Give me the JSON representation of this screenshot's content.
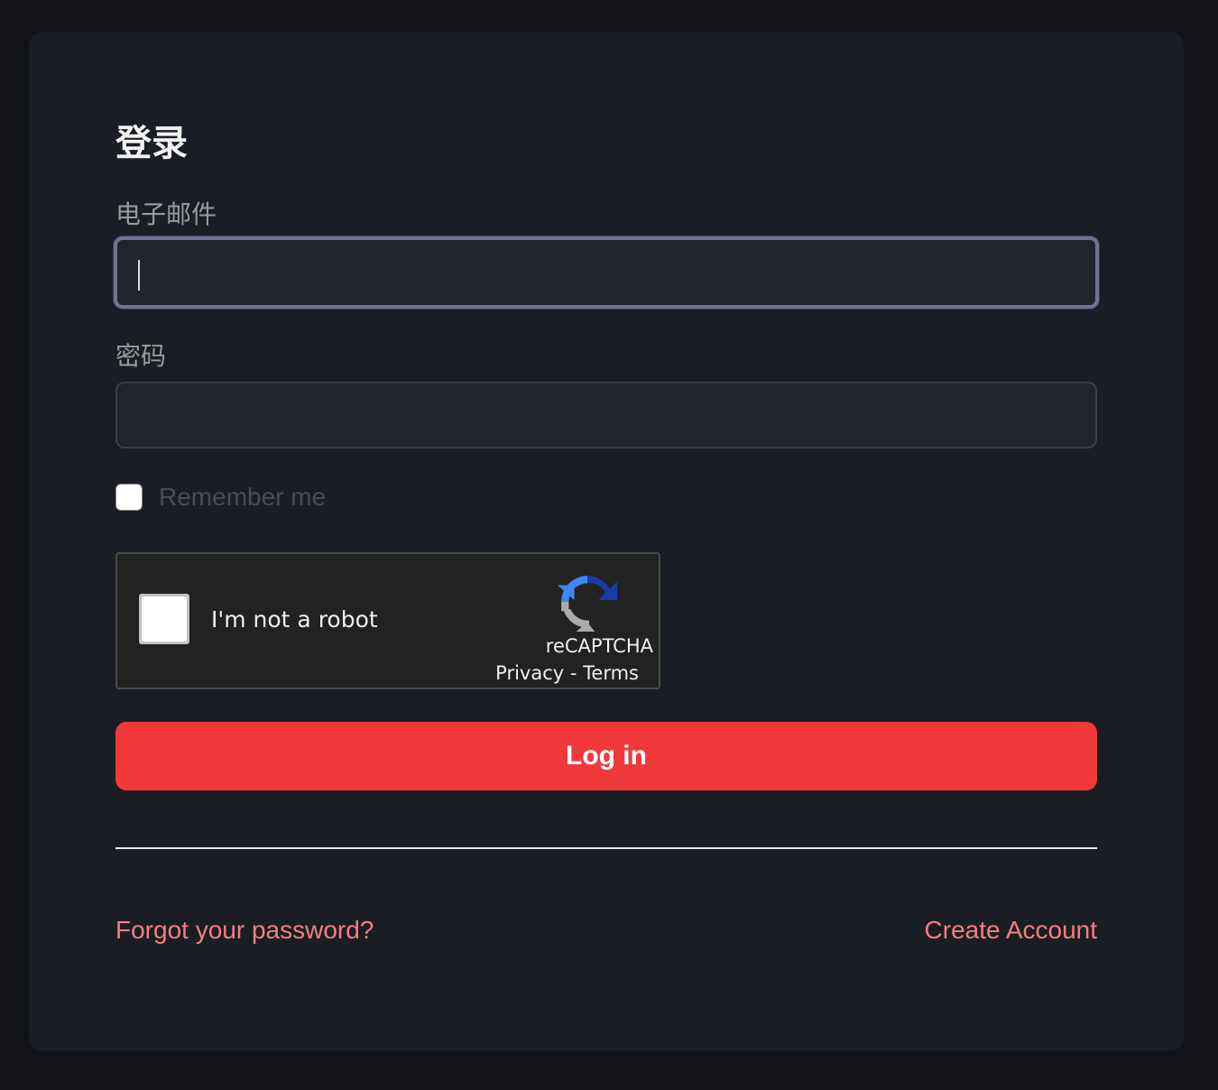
{
  "form": {
    "title": "登录",
    "email_label": "电子邮件",
    "email_value": "",
    "password_label": "密码",
    "password_value": "",
    "remember_label": "Remember me",
    "login_label": "Log in"
  },
  "recaptcha": {
    "label": "I'm not a robot",
    "brand": "reCAPTCHA",
    "privacy": "Privacy",
    "separator": "-",
    "terms": "Terms"
  },
  "links": {
    "forgot": "Forgot your password?",
    "create": "Create Account"
  },
  "colors": {
    "background": "#121318",
    "card": "#1b1d24",
    "accent": "#f0393b",
    "link": "#f27f82"
  }
}
